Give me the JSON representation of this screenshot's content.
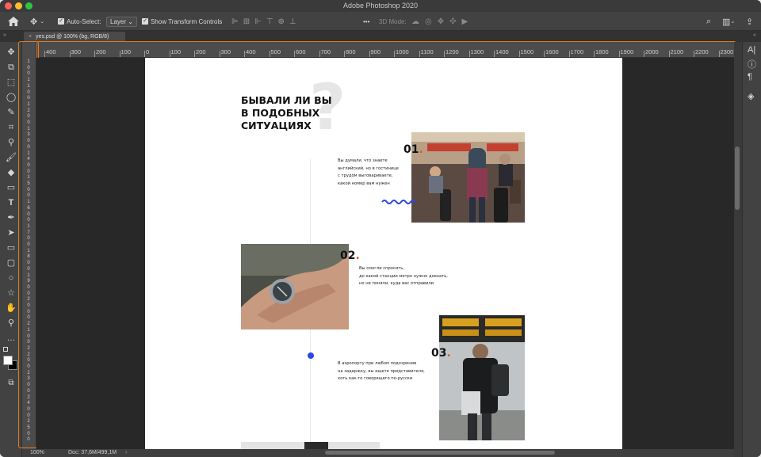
{
  "app": {
    "title": "Adobe Photoshop 2020"
  },
  "options_bar": {
    "auto_select_label": "Auto-Select:",
    "auto_select_value": "Layer",
    "show_transform_label": "Show Transform Controls",
    "mode_3d_label": "3D Mode:",
    "more_label": "•••"
  },
  "document_tab": {
    "title": "yes.psd @ 100% (bg, RGB/8)"
  },
  "ruler": {
    "h_ticks": [
      "400",
      "300",
      "200",
      "100",
      "0",
      "100",
      "200",
      "300",
      "400",
      "500",
      "600",
      "700",
      "800",
      "900",
      "1000",
      "1100",
      "1200",
      "1300",
      "1400",
      "1500",
      "1600",
      "1700",
      "1800",
      "1900",
      "2000",
      "2100",
      "2200",
      "2300"
    ],
    "v_labels": [
      "1",
      "0",
      "0",
      "1",
      "1",
      "0",
      "0",
      "1",
      "2",
      "0",
      "0",
      "1",
      "3",
      "0",
      "0",
      "1",
      "4",
      "0",
      "0",
      "1",
      "5",
      "0",
      "0",
      "1",
      "6",
      "0",
      "0",
      "1",
      "7",
      "0",
      "0",
      "1",
      "8",
      "0",
      "0",
      "1",
      "9",
      "0",
      "0",
      "2",
      "0",
      "0",
      "0",
      "2",
      "1",
      "0",
      "0",
      "2",
      "2",
      "0",
      "0",
      "2",
      "3",
      "0",
      "0",
      "2",
      "4",
      "0",
      "0",
      "2",
      "5",
      "0",
      "0"
    ]
  },
  "status_bar": {
    "zoom": "100%",
    "doc": "Doc: 37,6M/499,1M"
  },
  "canvas": {
    "heading_lines": [
      "БЫВАЛИ ЛИ ВЫ",
      "В ПОДОБНЫХ",
      "СИТУАЦИЯХ"
    ],
    "question_mark": "?",
    "items": [
      {
        "number": "01",
        "dot": ".",
        "text": "Вы думали, что знаете\nанглийский, но в гостинице\nс трудом выговариваете,\nкакой номер вам нужен"
      },
      {
        "number": "02",
        "dot": ".",
        "text": "Вы смогли спросить,\nдо какой станции метро нужно доехать,\nно не поняли, куда вас отправили"
      },
      {
        "number": "03",
        "dot": ".",
        "text": "В аэропорту при любом подозрении\nна задержку, вы ищете представителя,\nхоть как-то говорящего по-русски"
      }
    ]
  },
  "colors": {
    "accent_blue": "#2b46e6",
    "accent_orange": "#e05a1c",
    "highlight": "#e07b24"
  }
}
